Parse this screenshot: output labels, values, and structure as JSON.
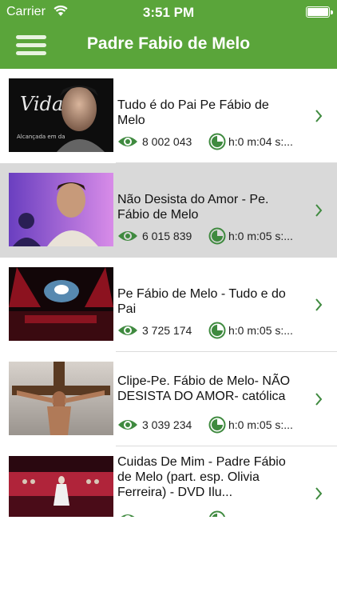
{
  "status_bar": {
    "carrier": "Carrier",
    "time": "3:51 PM"
  },
  "header": {
    "title": "Padre Fabio de Melo"
  },
  "icons": {
    "menu": "hamburger-menu-icon",
    "views": "eye-icon",
    "duration": "clock-icon",
    "disclosure": "chevron-right-icon"
  },
  "colors": {
    "accent": "#5aa53a",
    "icon_green": "#3f8a3f",
    "selected_row": "#d9d9d9"
  },
  "videos": [
    {
      "title": "Tudo é do Pai Pe Fábio de Melo",
      "views": "8 002 043",
      "duration": "h:0 m:04 s:...",
      "thumb_text_1": "Vida",
      "thumb_text_2": "Alcançada em             da"
    },
    {
      "title": "Não Desista do Amor - Pe. Fábio de Melo",
      "views": "6 015 839",
      "duration": "h:0 m:05 s:..."
    },
    {
      "title": "Pe Fábio de Melo - Tudo e do Pai",
      "views": "3 725 174",
      "duration": "h:0 m:05 s:..."
    },
    {
      "title": "Clipe-Pe. Fábio de Melo- NÃO DESISTA DO AMOR- católica",
      "views": "3 039 234",
      "duration": "h:0 m:05 s:..."
    },
    {
      "title": "Cuidas De Mim - Padre Fábio de Melo (part. esp. Olivia Ferreira)  - DVD Ilu...",
      "views": "",
      "duration": ""
    }
  ]
}
